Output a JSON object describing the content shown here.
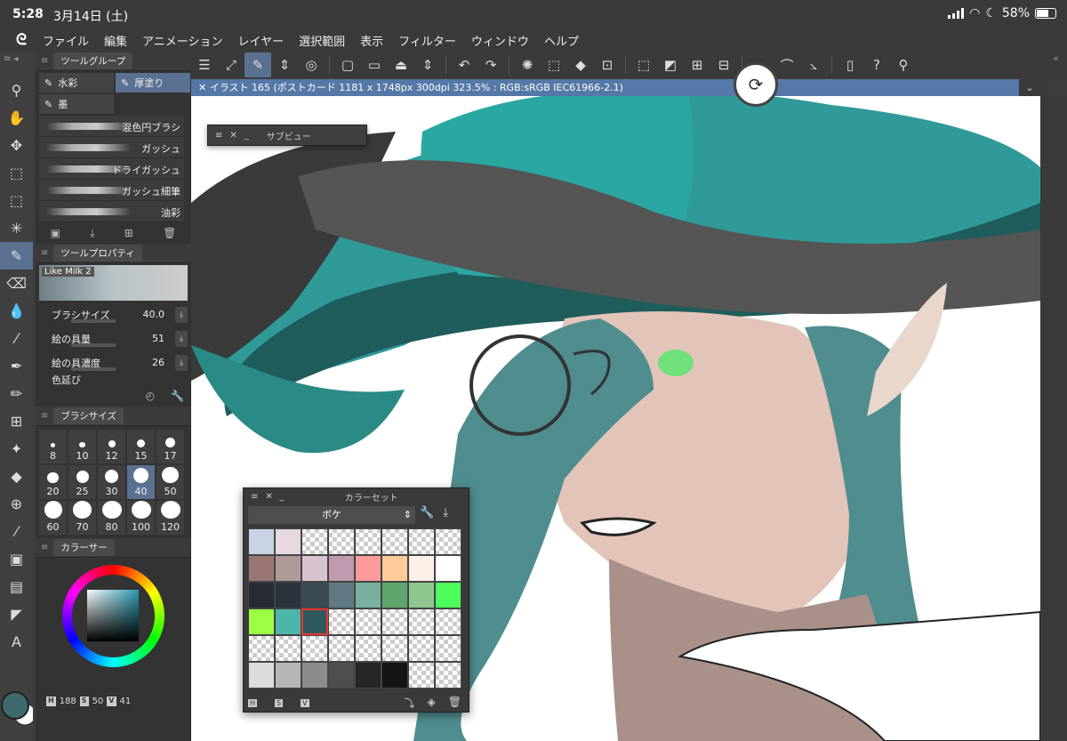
{
  "status": {
    "time": "5:28",
    "date": "3月14日 (土)",
    "battery": "58%"
  },
  "menu": [
    "ファイル",
    "編集",
    "アニメーション",
    "レイヤー",
    "選択範囲",
    "表示",
    "フィルター",
    "ウィンドウ",
    "ヘルプ"
  ],
  "document": {
    "tab_title": "イラスト 165 (ポストカード 1181 x 1748px 300dpi 323.5% : RGB:sRGB IEC61966-2.1)"
  },
  "tool_group": {
    "title": "ツールグループ",
    "sub_tools": [
      "水彩",
      "厚塗り",
      "墨"
    ],
    "active_sub_tool": "厚塗り",
    "brushes": [
      "混色円ブラシ",
      "ガッシュ",
      "ドライガッシュ",
      "ガッシュ細筆",
      "油彩"
    ]
  },
  "tool_property": {
    "title": "ツールプロパティ",
    "preset_name": "Like Milk 2",
    "rows": [
      {
        "label": "ブラシサイズ",
        "value": "40.0"
      },
      {
        "label": "絵の具量",
        "value": "51"
      },
      {
        "label": "絵の具濃度",
        "value": "26"
      },
      {
        "label": "色延び",
        "value": ""
      }
    ]
  },
  "brush_size": {
    "title": "ブラシサイズ",
    "sizes": [
      "8",
      "10",
      "12",
      "15",
      "17",
      "20",
      "25",
      "30",
      "40",
      "50",
      "60",
      "70",
      "80",
      "100",
      "120"
    ],
    "selected": "40"
  },
  "color": {
    "panel_title": "カラーサー",
    "hsv": {
      "h_label": "H",
      "h": "188",
      "s_label": "S",
      "s": "50",
      "v_label": "V",
      "v": "41"
    },
    "main_color": "#3d6a6e",
    "sub_color": "#ffffff"
  },
  "sub_view": {
    "title": "サブビュー"
  },
  "color_set": {
    "title": "カラーセット",
    "selected_set": "ボケ",
    "swatches": [
      "#c8d4e4",
      "#e8d8e2",
      "",
      "",
      "",
      "",
      "",
      "",
      "#9a7674",
      "#b09a98",
      "#d8c4d0",
      "#c09aae",
      "#ff9a9a",
      "#ffcc99",
      "#fdf0e6",
      "#ffffff",
      "#262b33",
      "#2a323c",
      "#3a4a55",
      "#5f7a82",
      "#7ab0a0",
      "#5fa66e",
      "#8ec890",
      "#4cff5a",
      "#9cff42",
      "#4cb6aa",
      "#2e5a5e",
      "",
      "",
      "",
      "",
      "",
      "",
      "",
      "",
      "",
      "",
      "",
      "",
      "",
      "#dcdcdc",
      "#b6b6b6",
      "#8c8c8c",
      "#4e4e4e",
      "#262626",
      "#141414",
      "",
      ""
    ],
    "selected_index": 26,
    "modes": [
      "H",
      "S",
      "V"
    ]
  }
}
